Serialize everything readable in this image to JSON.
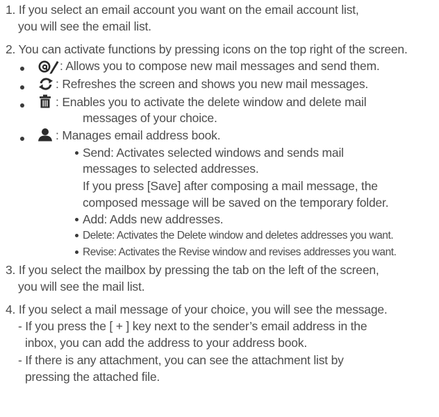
{
  "items": [
    {
      "l1": "1. If you select an email account you want on the email account list,",
      "l2": "you will see the email list."
    },
    {
      "l1": "2. You can activate functions by pressing icons on the top right of the screen."
    },
    {
      "l1": "3. If you select the mailbox by pressing the tab on the left of the screen,",
      "l2": "you will see the mail list."
    },
    {
      "l1": "4. If you select a mail message of your choice, you will see the message.",
      "sub": [
        {
          "l1": "- If you press the [ + ] key next to the sender’s email address in the",
          "l2": "inbox, you can add the address to your address book."
        },
        {
          "l1": "- If there is any attachment, you can see the attachment list by",
          "l2": "pressing the attached file."
        }
      ]
    }
  ],
  "icons": [
    {
      "icon": "compose-mail-icon",
      "l1": ": Allows you to compose new mail messages and send them."
    },
    {
      "icon": "refresh-icon",
      "l1": ": Refreshes the screen and shows you new mail messages."
    },
    {
      "icon": "trash-icon",
      "l1": ": Enables you to activate the delete window and delete mail",
      "l2": "messages of your choice."
    },
    {
      "icon": "person-icon",
      "l1": ": Manages email address book."
    }
  ],
  "address_book": [
    {
      "l1": "Send: Activates selected windows and sends mail",
      "l2": "messages to selected addresses.",
      "l3": "If you press [Save] after composing a mail message, the",
      "l4": "composed message will be saved on the temporary folder."
    },
    {
      "l1": "Add: Adds new addresses."
    },
    {
      "l1": "Delete: Activates the Delete window and deletes addresses you want."
    },
    {
      "l1": "Revise: Activates the Revise window and revises addresses you want."
    }
  ],
  "colors": {
    "text": "#4d4d4d",
    "icon": "#2b2b2b"
  }
}
